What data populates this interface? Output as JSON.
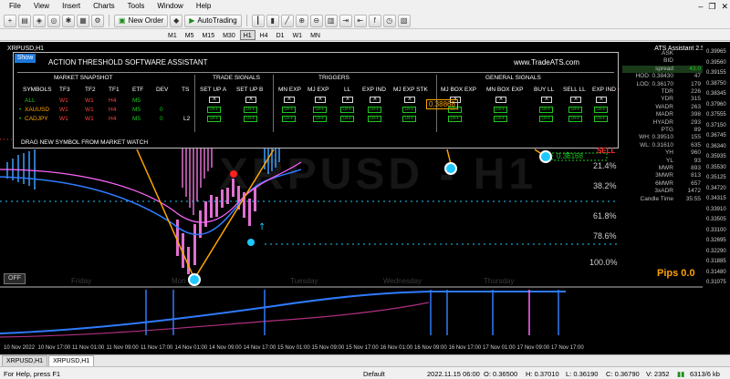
{
  "menu": [
    "File",
    "View",
    "Insert",
    "Charts",
    "Tools",
    "Window",
    "Help"
  ],
  "toolbar": {
    "new_order": "New Order",
    "autotrading": "AutoTrading"
  },
  "timeframes": [
    "M1",
    "M5",
    "M15",
    "M30",
    "H1",
    "H4",
    "D1",
    "W1",
    "MN"
  ],
  "active_timeframe": "H1",
  "chart": {
    "symbol_title": "XRPUSD,H1",
    "ats_title": "ATS Assistant 2.5",
    "watermark": "XRPUSD - H1",
    "fib_levels": [
      "21.4%",
      "38.2%",
      "61.8%",
      "78.6%",
      "100.0%"
    ],
    "day_labels": [
      "Friday",
      "Mon",
      "Tuesday",
      "Wednesday",
      "Thursday"
    ],
    "buy_price": "0.38868",
    "sell_price": "0.36168",
    "sell_label": "SELL",
    "pips": "Pips 0.0",
    "off_button": "OFF",
    "price_axis": [
      "0.39965",
      "0.39560",
      "0.39155",
      "0.38750",
      "0.38345",
      "0.37960",
      "0.37555",
      "0.37150",
      "0.36745",
      "0.36340",
      "0.35935",
      "0.35530",
      "0.35125",
      "0.34720",
      "0.34315",
      "0.33910",
      "0.33505",
      "0.33100",
      "0.32695",
      "0.32290",
      "0.31885",
      "0.31480",
      "0.31075"
    ],
    "time_axis": [
      "10 Nov 2022",
      "10 Nov 17:00",
      "11 Nov 01:00",
      "11 Nov 09:00",
      "11 Nov 17:00",
      "14 Nov 01:00",
      "14 Nov 09:00",
      "14 Nov 17:00",
      "15 Nov 01:00",
      "15 Nov 09:00",
      "15 Nov 17:00",
      "16 Nov 01:00",
      "16 Nov 09:00",
      "16 Nov 17:00",
      "17 Nov 01:00",
      "17 Nov 09:00",
      "17 Nov 17:00"
    ]
  },
  "panel": {
    "show": "Show",
    "title": "ACTION THRESHOLD SOFTWARE ASSISTANT",
    "url": "www.TradeATS.com",
    "sections": [
      "MARKET SNAPSHOT",
      "TRADE SIGNALS",
      "TRIGGERS",
      "GENERAL SIGNALS"
    ],
    "headers": [
      "SYMBOLS",
      "TF3",
      "TF2",
      "TF1",
      "ETF",
      "DEV",
      "TS",
      "SET UP A",
      "SET UP B",
      "MN EXP",
      "MJ EXP",
      "LL",
      "EXP IND",
      "MJ EXP STK",
      "MJ BOX EXP",
      "MN BOX EXP",
      "BUY LL",
      "SELL LL",
      "EXP IND"
    ],
    "rows": [
      {
        "symbol": "ALL",
        "tf3": "W1",
        "tf2": "W1",
        "tf1": "H4",
        "etf": "M5",
        "dev": "",
        "ts": ""
      },
      {
        "symbol": "XAUUSD",
        "tf3": "W1",
        "tf2": "W1",
        "tf1": "H4",
        "etf": "M5",
        "dev": "0",
        "ts": ""
      },
      {
        "symbol": "CADJPY",
        "tf3": "W1",
        "tf2": "W1",
        "tf1": "H4",
        "etf": "M5",
        "dev": "0",
        "ts": "L2"
      }
    ],
    "x_label": "X",
    "off_label": "OFF",
    "drag": "DRAG NEW SYMBOL FROM MARKET WATCH"
  },
  "stats": [
    {
      "k": "ASK",
      "v": ""
    },
    {
      "k": "BID",
      "v": ""
    },
    {
      "k": "spread",
      "v": "43.0"
    },
    {
      "k": "HOD: 0.38430",
      "v": "47"
    },
    {
      "k": "LOD: 0.36170",
      "v": "179"
    },
    {
      "k": "TDR",
      "v": "226"
    },
    {
      "k": "YDR",
      "v": "315"
    },
    {
      "k": "WADR",
      "v": "263"
    },
    {
      "k": "MADR",
      "v": "398"
    },
    {
      "k": "HYADR",
      "v": "293"
    },
    {
      "k": "PTG",
      "v": "89"
    },
    {
      "k": "WH: 0.39510",
      "v": "155"
    },
    {
      "k": "WL: 0.31610",
      "v": "635"
    },
    {
      "k": "YH",
      "v": "960"
    },
    {
      "k": "YL",
      "v": "93"
    },
    {
      "k": "MWR",
      "v": "893"
    },
    {
      "k": "3MWR",
      "v": "813"
    },
    {
      "k": "6MWR",
      "v": "657"
    },
    {
      "k": "3xADR",
      "v": "1472"
    },
    {
      "k": "Candle Time",
      "v": "35:55"
    }
  ],
  "tabs": [
    "XRPUSD,H1",
    "XRPUSD,H1"
  ],
  "status": {
    "help": "For Help, press F1",
    "profile": "Default",
    "time": "2022.11.15 06:00",
    "open": "O: 0.36500",
    "high": "H: 0.37010",
    "low": "L: 0.36190",
    "close": "C: 0.36790",
    "volume": "V: 2352",
    "traffic": "6313/6 kb"
  },
  "colors": {
    "accent_blue": "#1e78d8",
    "magenta": "#ff66ff",
    "orange": "#ffa500",
    "cyan": "#1ec8ff",
    "green": "#1fc81f"
  }
}
